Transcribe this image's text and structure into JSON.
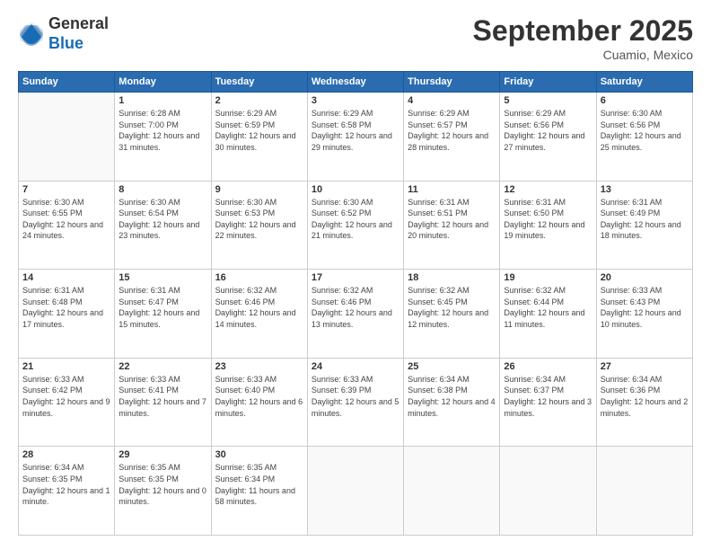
{
  "logo": {
    "general": "General",
    "blue": "Blue"
  },
  "header": {
    "month": "September 2025",
    "location": "Cuamio, Mexico"
  },
  "days_of_week": [
    "Sunday",
    "Monday",
    "Tuesday",
    "Wednesday",
    "Thursday",
    "Friday",
    "Saturday"
  ],
  "weeks": [
    [
      {
        "day": "",
        "sunrise": "",
        "sunset": "",
        "daylight": ""
      },
      {
        "day": "1",
        "sunrise": "Sunrise: 6:28 AM",
        "sunset": "Sunset: 7:00 PM",
        "daylight": "Daylight: 12 hours and 31 minutes."
      },
      {
        "day": "2",
        "sunrise": "Sunrise: 6:29 AM",
        "sunset": "Sunset: 6:59 PM",
        "daylight": "Daylight: 12 hours and 30 minutes."
      },
      {
        "day": "3",
        "sunrise": "Sunrise: 6:29 AM",
        "sunset": "Sunset: 6:58 PM",
        "daylight": "Daylight: 12 hours and 29 minutes."
      },
      {
        "day": "4",
        "sunrise": "Sunrise: 6:29 AM",
        "sunset": "Sunset: 6:57 PM",
        "daylight": "Daylight: 12 hours and 28 minutes."
      },
      {
        "day": "5",
        "sunrise": "Sunrise: 6:29 AM",
        "sunset": "Sunset: 6:56 PM",
        "daylight": "Daylight: 12 hours and 27 minutes."
      },
      {
        "day": "6",
        "sunrise": "Sunrise: 6:30 AM",
        "sunset": "Sunset: 6:56 PM",
        "daylight": "Daylight: 12 hours and 25 minutes."
      }
    ],
    [
      {
        "day": "7",
        "sunrise": "Sunrise: 6:30 AM",
        "sunset": "Sunset: 6:55 PM",
        "daylight": "Daylight: 12 hours and 24 minutes."
      },
      {
        "day": "8",
        "sunrise": "Sunrise: 6:30 AM",
        "sunset": "Sunset: 6:54 PM",
        "daylight": "Daylight: 12 hours and 23 minutes."
      },
      {
        "day": "9",
        "sunrise": "Sunrise: 6:30 AM",
        "sunset": "Sunset: 6:53 PM",
        "daylight": "Daylight: 12 hours and 22 minutes."
      },
      {
        "day": "10",
        "sunrise": "Sunrise: 6:30 AM",
        "sunset": "Sunset: 6:52 PM",
        "daylight": "Daylight: 12 hours and 21 minutes."
      },
      {
        "day": "11",
        "sunrise": "Sunrise: 6:31 AM",
        "sunset": "Sunset: 6:51 PM",
        "daylight": "Daylight: 12 hours and 20 minutes."
      },
      {
        "day": "12",
        "sunrise": "Sunrise: 6:31 AM",
        "sunset": "Sunset: 6:50 PM",
        "daylight": "Daylight: 12 hours and 19 minutes."
      },
      {
        "day": "13",
        "sunrise": "Sunrise: 6:31 AM",
        "sunset": "Sunset: 6:49 PM",
        "daylight": "Daylight: 12 hours and 18 minutes."
      }
    ],
    [
      {
        "day": "14",
        "sunrise": "Sunrise: 6:31 AM",
        "sunset": "Sunset: 6:48 PM",
        "daylight": "Daylight: 12 hours and 17 minutes."
      },
      {
        "day": "15",
        "sunrise": "Sunrise: 6:31 AM",
        "sunset": "Sunset: 6:47 PM",
        "daylight": "Daylight: 12 hours and 15 minutes."
      },
      {
        "day": "16",
        "sunrise": "Sunrise: 6:32 AM",
        "sunset": "Sunset: 6:46 PM",
        "daylight": "Daylight: 12 hours and 14 minutes."
      },
      {
        "day": "17",
        "sunrise": "Sunrise: 6:32 AM",
        "sunset": "Sunset: 6:46 PM",
        "daylight": "Daylight: 12 hours and 13 minutes."
      },
      {
        "day": "18",
        "sunrise": "Sunrise: 6:32 AM",
        "sunset": "Sunset: 6:45 PM",
        "daylight": "Daylight: 12 hours and 12 minutes."
      },
      {
        "day": "19",
        "sunrise": "Sunrise: 6:32 AM",
        "sunset": "Sunset: 6:44 PM",
        "daylight": "Daylight: 12 hours and 11 minutes."
      },
      {
        "day": "20",
        "sunrise": "Sunrise: 6:33 AM",
        "sunset": "Sunset: 6:43 PM",
        "daylight": "Daylight: 12 hours and 10 minutes."
      }
    ],
    [
      {
        "day": "21",
        "sunrise": "Sunrise: 6:33 AM",
        "sunset": "Sunset: 6:42 PM",
        "daylight": "Daylight: 12 hours and 9 minutes."
      },
      {
        "day": "22",
        "sunrise": "Sunrise: 6:33 AM",
        "sunset": "Sunset: 6:41 PM",
        "daylight": "Daylight: 12 hours and 7 minutes."
      },
      {
        "day": "23",
        "sunrise": "Sunrise: 6:33 AM",
        "sunset": "Sunset: 6:40 PM",
        "daylight": "Daylight: 12 hours and 6 minutes."
      },
      {
        "day": "24",
        "sunrise": "Sunrise: 6:33 AM",
        "sunset": "Sunset: 6:39 PM",
        "daylight": "Daylight: 12 hours and 5 minutes."
      },
      {
        "day": "25",
        "sunrise": "Sunrise: 6:34 AM",
        "sunset": "Sunset: 6:38 PM",
        "daylight": "Daylight: 12 hours and 4 minutes."
      },
      {
        "day": "26",
        "sunrise": "Sunrise: 6:34 AM",
        "sunset": "Sunset: 6:37 PM",
        "daylight": "Daylight: 12 hours and 3 minutes."
      },
      {
        "day": "27",
        "sunrise": "Sunrise: 6:34 AM",
        "sunset": "Sunset: 6:36 PM",
        "daylight": "Daylight: 12 hours and 2 minutes."
      }
    ],
    [
      {
        "day": "28",
        "sunrise": "Sunrise: 6:34 AM",
        "sunset": "Sunset: 6:35 PM",
        "daylight": "Daylight: 12 hours and 1 minute."
      },
      {
        "day": "29",
        "sunrise": "Sunrise: 6:35 AM",
        "sunset": "Sunset: 6:35 PM",
        "daylight": "Daylight: 12 hours and 0 minutes."
      },
      {
        "day": "30",
        "sunrise": "Sunrise: 6:35 AM",
        "sunset": "Sunset: 6:34 PM",
        "daylight": "Daylight: 11 hours and 58 minutes."
      },
      {
        "day": "",
        "sunrise": "",
        "sunset": "",
        "daylight": ""
      },
      {
        "day": "",
        "sunrise": "",
        "sunset": "",
        "daylight": ""
      },
      {
        "day": "",
        "sunrise": "",
        "sunset": "",
        "daylight": ""
      },
      {
        "day": "",
        "sunrise": "",
        "sunset": "",
        "daylight": ""
      }
    ]
  ]
}
